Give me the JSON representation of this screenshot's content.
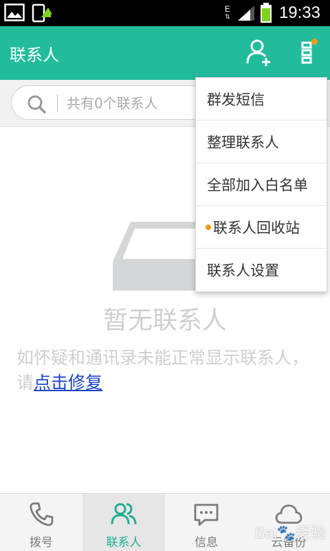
{
  "status_bar": {
    "time": "19:33",
    "network_type": "E",
    "network_arrows": "⇅",
    "colors": {
      "battery": "#7ed321"
    },
    "icons": [
      "gallery-notification-icon",
      "update-notification-icon",
      "data-network-icon",
      "signal-icon",
      "battery-icon"
    ]
  },
  "app_bar": {
    "title": "联系人",
    "color": "#22bc9c",
    "icons": [
      "add-contact-icon",
      "more-menu-icon"
    ]
  },
  "search": {
    "placeholder": "共有0个联系人"
  },
  "empty_state": {
    "title": "暂无联系人",
    "description": "如怀疑和通讯录未能正常显示联系人，请",
    "fix_link": "点击修复"
  },
  "dropdown_menu": {
    "items": [
      {
        "label": "群发短信",
        "has_dot": false
      },
      {
        "label": "整理联系人",
        "has_dot": false
      },
      {
        "label": "全部加入白名单",
        "has_dot": false
      },
      {
        "label": "联系人回收站",
        "has_dot": true
      },
      {
        "label": "联系人设置",
        "has_dot": false
      }
    ]
  },
  "bottom_nav": {
    "items": [
      {
        "label": "拨号",
        "icon": "phone-icon",
        "active": false
      },
      {
        "label": "联系人",
        "icon": "contacts-icon",
        "active": true
      },
      {
        "label": "信息",
        "icon": "message-icon",
        "active": false
      },
      {
        "label": "云备份",
        "icon": "cloud-backup-icon",
        "active": false
      }
    ],
    "active_color": "#1fae91"
  },
  "watermark": "Bai🐾经验"
}
